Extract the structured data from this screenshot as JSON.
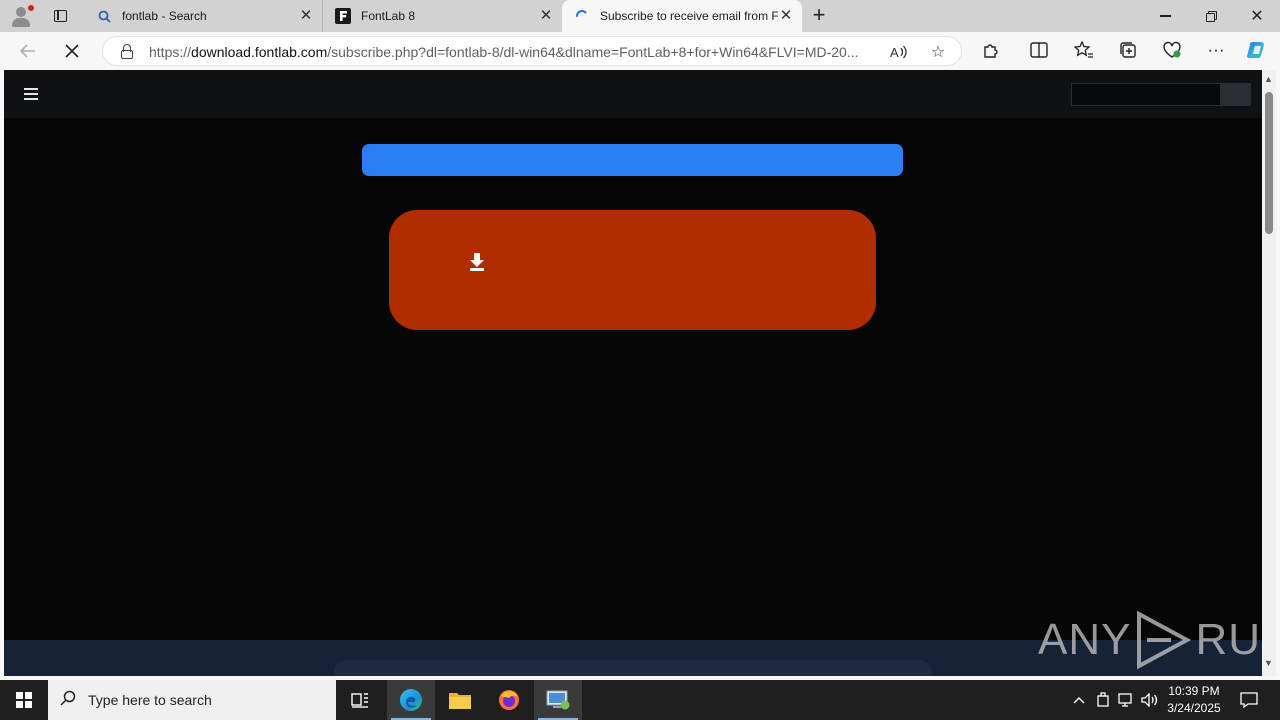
{
  "browser": {
    "tabs": [
      {
        "label": "fontlab - Search",
        "icon": "search-icon",
        "active": false
      },
      {
        "label": "FontLab 8",
        "icon": "fontlab-logo-icon",
        "active": false
      },
      {
        "label": "Subscribe to receive email from F",
        "icon": "loading-spinner-icon",
        "active": true
      }
    ],
    "new_tab_label": "+",
    "url": {
      "prefix": "https://",
      "domain": "download.fontlab.com",
      "path": "/subscribe.php?dl=fontlab-8/dl-win64&dlname=FontLab+8+for+Win64&FLVI=MD-20..."
    },
    "toolbar_icons": [
      "read-aloud-icon",
      "favorite-star-icon",
      "extensions-icon",
      "split-screen-icon",
      "favorites-icon",
      "collections-icon",
      "browser-essentials-icon",
      "more-icon",
      "copilot-icon"
    ],
    "accent_color": "#1a73e8"
  },
  "page": {
    "header": {
      "menu_icon": "hamburger-menu-icon",
      "search_placeholder": ""
    },
    "download_button": {
      "icon": "download-icon",
      "color": "#b02d00"
    },
    "banner": {
      "color": "#2b7ff5"
    },
    "watermark": {
      "left": "ANY",
      "right": "RUN"
    }
  },
  "taskbar": {
    "search_placeholder": "Type here to search",
    "apps": [
      "task-view-icon",
      "edge-icon",
      "file-explorer-icon",
      "firefox-icon",
      "network-tool-icon"
    ],
    "time": "10:39 PM",
    "date": "3/24/2025"
  }
}
